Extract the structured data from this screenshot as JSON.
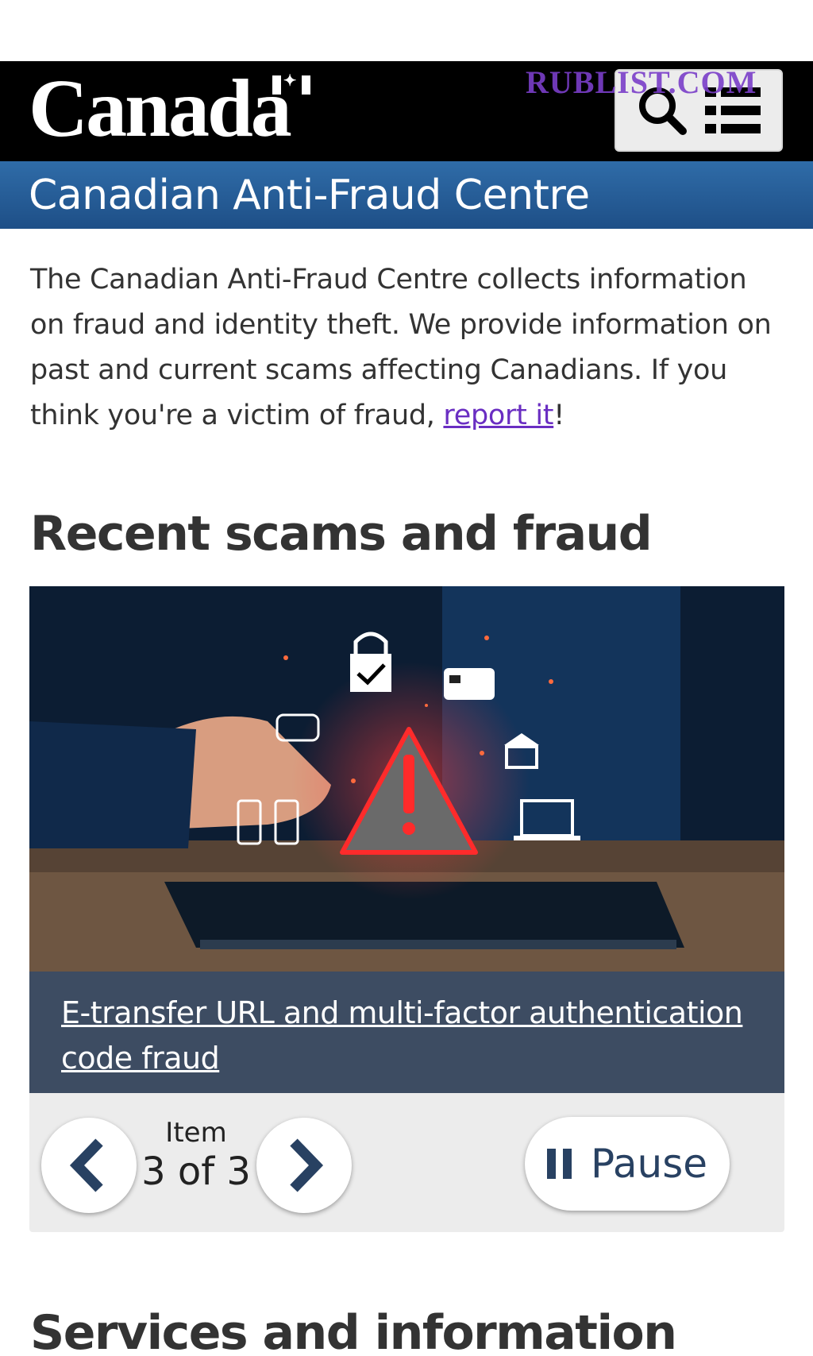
{
  "header": {
    "wordmark": "Canada",
    "watermark": "RUBLIST.COM",
    "search_icon": "search-icon",
    "menu_icon": "menu-list-icon"
  },
  "banner": {
    "title": "Canadian Anti-Fraud Centre"
  },
  "intro": {
    "text_before_link": "The Canadian Anti-Fraud Centre collects information on fraud and identity theft. We provide information on past and current scams affecting Canadians. If you think you're a victim of fraud, ",
    "link_text": "report it",
    "text_after_link": "!",
    "link_color": "#6a2ec2"
  },
  "recent": {
    "heading": "Recent scams and fraud",
    "slide": {
      "caption": "E-transfer URL and multi-factor authentication code fraud"
    },
    "controls": {
      "item_label": "Item",
      "item_count": "3 of 3",
      "pause_label": "Pause",
      "prev_icon": "chevron-left-icon",
      "next_icon": "chevron-right-icon"
    }
  },
  "services": {
    "heading": "Services and information"
  },
  "colors": {
    "gc_bar": "#000000",
    "banner": "#26598f",
    "caption_bg": "#3d4c62",
    "controls_bg": "#ececec",
    "accent": "#284162"
  }
}
